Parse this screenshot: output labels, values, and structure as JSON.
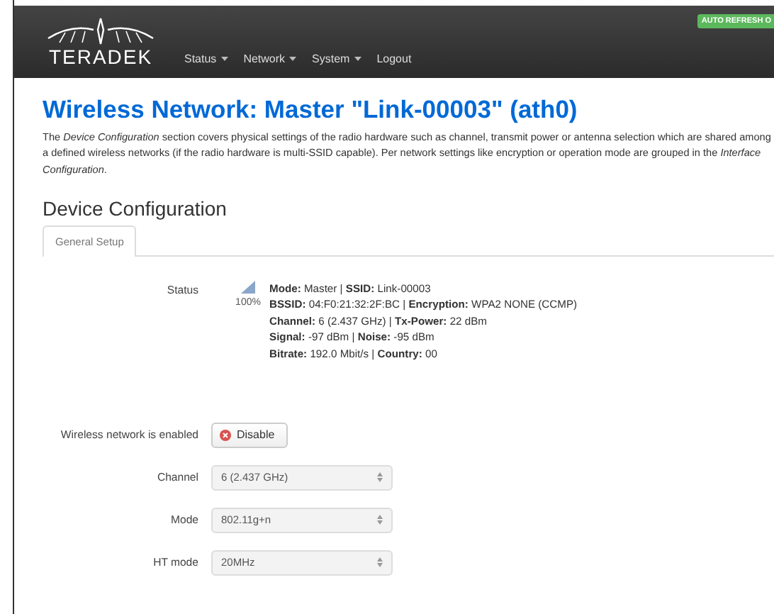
{
  "header": {
    "logo": "TERADEK",
    "nav": [
      {
        "label": "Status",
        "dropdown": true
      },
      {
        "label": "Network",
        "dropdown": true
      },
      {
        "label": "System",
        "dropdown": true
      },
      {
        "label": "Logout",
        "dropdown": false
      }
    ],
    "badge": "AUTO REFRESH O"
  },
  "title": "Wireless Network: Master \"Link-00003\" (ath0)",
  "description": "The *Device Configuration* section covers physical settings of the radio hardware such as channel, transmit power or antenna selection which are shared among a defined wireless networks (if the radio hardware is multi-SSID capable). Per network settings like encryption or operation mode are grouped in the *Interface Configuration*.",
  "section_title": "Device Configuration",
  "tabs": [
    {
      "label": "General Setup",
      "selected": true
    }
  ],
  "status": {
    "label": "Status",
    "signal_percent": "100%",
    "lines": [
      "**Mode:** Master | **SSID:** Link-00003",
      "**BSSID:** 04:F0:21:32:2F:BC | **Encryption:** WPA2 NONE (CCMP)",
      "**Channel:** 6 (2.437 GHz) | **Tx-Power:** 22 dBm",
      "**Signal:** -97 dBm | **Noise:** -95 dBm",
      "**Bitrate:** 192.0 Mbit/s | **Country:** 00"
    ]
  },
  "fields": [
    {
      "kind": "button",
      "label": "Wireless network is enabled",
      "value": "Disable"
    },
    {
      "kind": "select",
      "label": "Channel",
      "value": "6 (2.437 GHz)"
    },
    {
      "kind": "select",
      "label": "Mode",
      "value": "802.11g+n"
    },
    {
      "kind": "select",
      "label": "HT mode",
      "value": "20MHz"
    }
  ]
}
